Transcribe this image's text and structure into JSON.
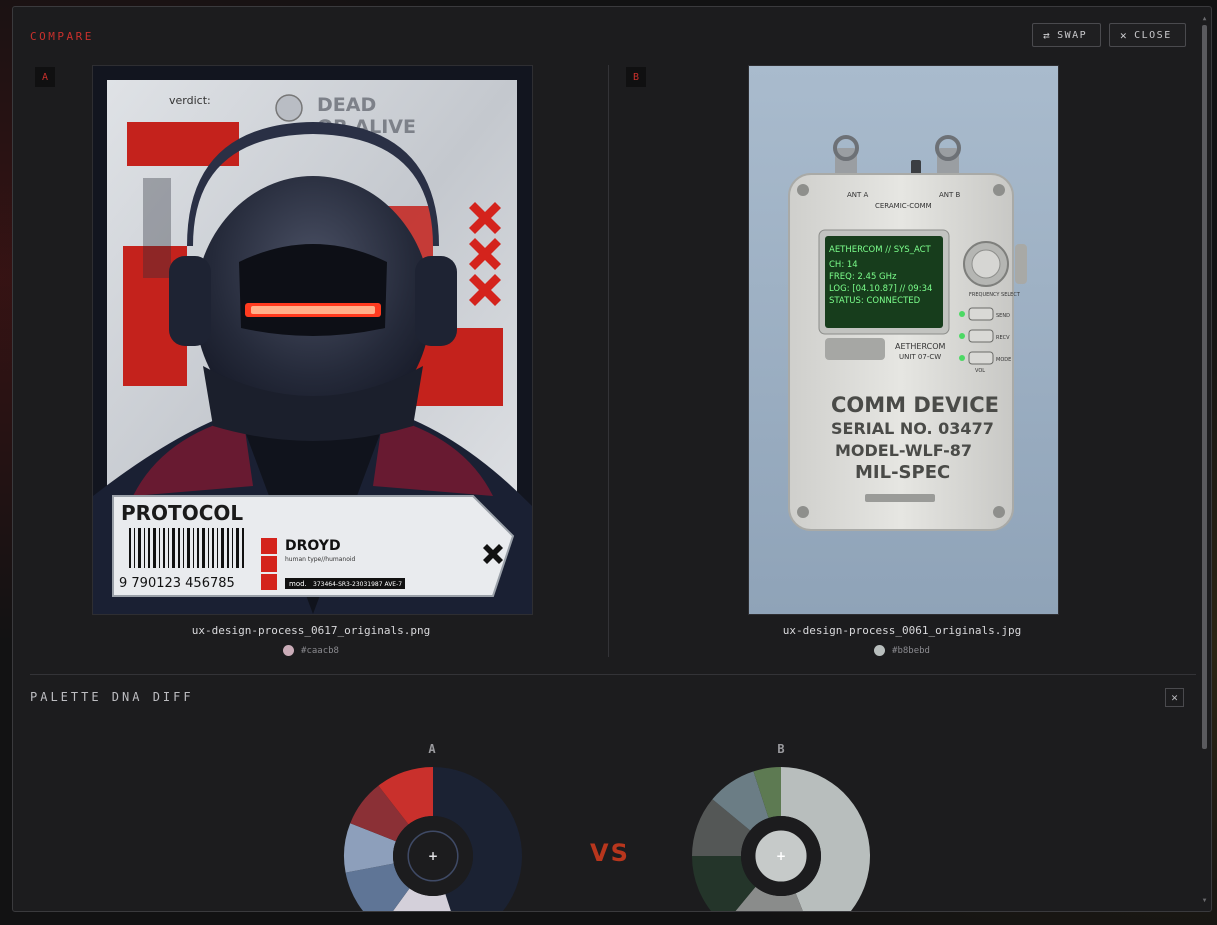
{
  "modal": {
    "title": "COMPARE",
    "swap_label": "SWAP",
    "close_label": "CLOSE"
  },
  "panels": [
    {
      "badge": "A",
      "filename": "ux-design-process_0617_originals.png",
      "swatch_hex": "#caacb8",
      "swatch_label": "#caacb8",
      "poster": {
        "verdict": "verdict:",
        "headline_1": "DEAD",
        "headline_2": "OR ALIVE",
        "protocol": "PROTOCOL",
        "barcode_number": "9  790123  456785",
        "name": "DROYD",
        "type": "human type//humanoid",
        "mod_label": "mod.",
        "mod_value": "373464-SR3-23031987 AVE-7"
      }
    },
    {
      "badge": "B",
      "filename": "ux-design-process_0061_originals.jpg",
      "swatch_hex": "#b8bebd",
      "swatch_label": "#b8bebd",
      "device": {
        "ant_a": "ANT A",
        "ant_b": "ANT B",
        "brand": "CERAMIC-COMM",
        "screen_lines": [
          "AETHERCOM // SYS_ACT",
          "CH: 14",
          "FREQ: 2.45 GHz",
          "LOG: [04.10.87] // 09:34",
          "STATUS: CONNECTED"
        ],
        "freq_select": "FREQUENCY SELECT",
        "btn_send": "SEND",
        "btn_recv": "RECV",
        "btn_mode": "MODE",
        "vol": "VOL",
        "unit_1": "AETHERCOM",
        "unit_2": "UNIT 07-CW",
        "stencil": [
          "COMM DEVICE",
          "SERIAL NO. 03477",
          "MODEL-WLF-87",
          "MIL-SPEC"
        ]
      }
    }
  ],
  "palette": {
    "title": "PALETTE DNA DIFF",
    "vs_label": "VS",
    "center_glyph": "+",
    "donuts": [
      {
        "label": "A",
        "segments": [
          {
            "fraction": 0.45,
            "color": "#1b2233"
          },
          {
            "fraction": 0.15,
            "color": "#d4d0da"
          },
          {
            "fraction": 0.12,
            "color": "#5f7596"
          },
          {
            "fraction": 0.09,
            "color": "#8d9fbb"
          },
          {
            "fraction": 0.085,
            "color": "#8b3036"
          },
          {
            "fraction": 0.105,
            "color": "#c9302c"
          }
        ]
      },
      {
        "label": "B",
        "segments": [
          {
            "fraction": 0.44,
            "color": "#b8bebd"
          },
          {
            "fraction": 0.17,
            "color": "#8a8c8b"
          },
          {
            "fraction": 0.14,
            "color": "#24352a"
          },
          {
            "fraction": 0.11,
            "color": "#545756"
          },
          {
            "fraction": 0.09,
            "color": "#6b7d85"
          },
          {
            "fraction": 0.05,
            "color": "#5d7a52"
          }
        ]
      }
    ]
  },
  "icons": {
    "swap": "swap-icon",
    "close": "close-icon"
  }
}
